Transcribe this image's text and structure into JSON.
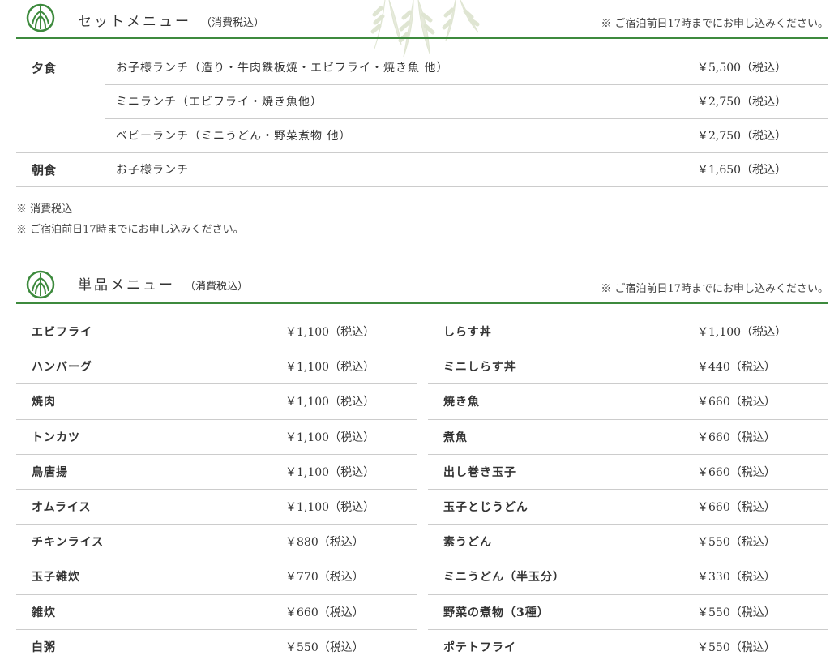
{
  "set_menu": {
    "title": "セットメニュー",
    "subtitle": "（消費税込）",
    "note": "※ ご宿泊前日17時までにお申し込みください。",
    "rows": [
      {
        "meal": "夕食",
        "item": "お子様ランチ（造り・牛肉鉄板焼・エビフライ・焼き魚 他）",
        "price": "￥5,500（税込）"
      },
      {
        "meal": "",
        "item": "ミニランチ（エビフライ・焼き魚他）",
        "price": "￥2,750（税込）"
      },
      {
        "meal": "",
        "item": "ベビーランチ（ミニうどん・野菜煮物 他）",
        "price": "￥2,750（税込）"
      },
      {
        "meal": "朝食",
        "item": "お子様ランチ",
        "price": "￥1,650（税込）"
      }
    ]
  },
  "notes": [
    "※ 消費税込",
    "※ ご宿泊前日17時までにお申し込みください。"
  ],
  "a_la_carte": {
    "title": "単品メニュー",
    "subtitle": "（消費税込）",
    "note": "※ ご宿泊前日17時までにお申し込みください。",
    "left": [
      {
        "name": "エビフライ",
        "price": "￥1,100（税込）"
      },
      {
        "name": "ハンバーグ",
        "price": "￥1,100（税込）"
      },
      {
        "name": "焼肉",
        "price": "￥1,100（税込）"
      },
      {
        "name": "トンカツ",
        "price": "￥1,100（税込）"
      },
      {
        "name": "鳥唐揚",
        "price": "￥1,100（税込）"
      },
      {
        "name": "オムライス",
        "price": "￥1,100（税込）"
      },
      {
        "name": "チキンライス",
        "price": "￥880（税込）"
      },
      {
        "name": "玉子雑炊",
        "price": "￥770（税込）"
      },
      {
        "name": "雑炊",
        "price": "￥660（税込）"
      },
      {
        "name": "白粥",
        "price": "￥550（税込）"
      }
    ],
    "right": [
      {
        "name": "しらす丼",
        "price": "￥1,100（税込）"
      },
      {
        "name": "ミニしらす丼",
        "price": "￥440（税込）"
      },
      {
        "name": "焼き魚",
        "price": "￥660（税込）"
      },
      {
        "name": "煮魚",
        "price": "￥660（税込）"
      },
      {
        "name": "出し巻き玉子",
        "price": "￥660（税込）"
      },
      {
        "name": "玉子とじうどん",
        "price": "￥660（税込）"
      },
      {
        "name": "素うどん",
        "price": "￥550（税込）"
      },
      {
        "name": "ミニうどん（半玉分）",
        "price": "￥330（税込）"
      },
      {
        "name": "野菜の煮物（3種）",
        "price": "￥550（税込）"
      },
      {
        "name": "ポテトフライ",
        "price": "￥550（税込）"
      }
    ]
  },
  "icons": {
    "logo": "willow-crest-icon",
    "decoration": "willow-leaves-icon"
  },
  "colors": {
    "accent": "#3d8a3d",
    "divider": "#cccccc",
    "text": "#333333"
  }
}
